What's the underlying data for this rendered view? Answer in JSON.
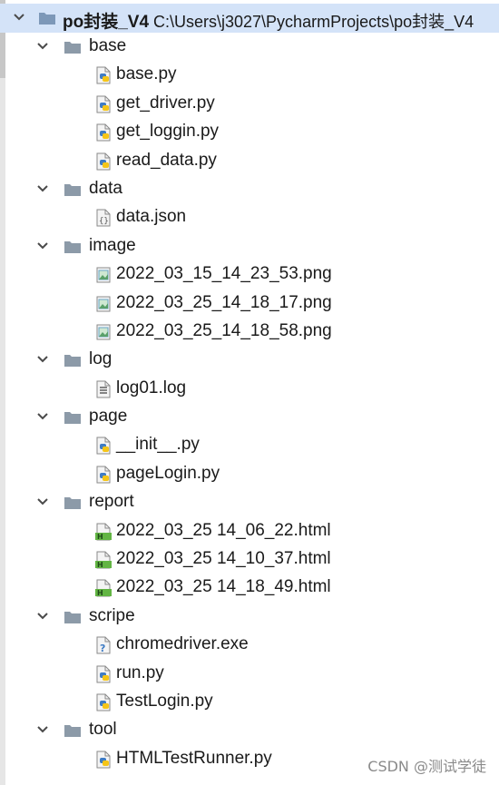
{
  "project": {
    "name": "po封装_V4",
    "path": "C:\\Users\\j3027\\PycharmProjects\\po封装_V4"
  },
  "tree": [
    {
      "kind": "folder",
      "label": "base",
      "depth": 1
    },
    {
      "kind": "python",
      "label": "base.py",
      "depth": 2
    },
    {
      "kind": "python",
      "label": "get_driver.py",
      "depth": 2
    },
    {
      "kind": "python",
      "label": "get_loggin.py",
      "depth": 2
    },
    {
      "kind": "python",
      "label": "read_data.py",
      "depth": 2
    },
    {
      "kind": "folder",
      "label": "data",
      "depth": 1
    },
    {
      "kind": "json",
      "label": "data.json",
      "depth": 2
    },
    {
      "kind": "folder",
      "label": "image",
      "depth": 1
    },
    {
      "kind": "png",
      "label": "2022_03_15_14_23_53.png",
      "depth": 2
    },
    {
      "kind": "png",
      "label": "2022_03_25_14_18_17.png",
      "depth": 2
    },
    {
      "kind": "png",
      "label": "2022_03_25_14_18_58.png",
      "depth": 2
    },
    {
      "kind": "folder",
      "label": "log",
      "depth": 1
    },
    {
      "kind": "log",
      "label": "log01.log",
      "depth": 2
    },
    {
      "kind": "folder",
      "label": "page",
      "depth": 1
    },
    {
      "kind": "python",
      "label": "__init__.py",
      "depth": 2
    },
    {
      "kind": "python",
      "label": "pageLogin.py",
      "depth": 2
    },
    {
      "kind": "folder",
      "label": "report",
      "depth": 1
    },
    {
      "kind": "html",
      "label": "2022_03_25 14_06_22.html",
      "depth": 2
    },
    {
      "kind": "html",
      "label": "2022_03_25 14_10_37.html",
      "depth": 2
    },
    {
      "kind": "html",
      "label": "2022_03_25 14_18_49.html",
      "depth": 2
    },
    {
      "kind": "folder",
      "label": "scripe",
      "depth": 1
    },
    {
      "kind": "unknown",
      "label": "chromedriver.exe",
      "depth": 2
    },
    {
      "kind": "python",
      "label": "run.py",
      "depth": 2
    },
    {
      "kind": "python",
      "label": "TestLogin.py",
      "depth": 2
    },
    {
      "kind": "folder",
      "label": "tool",
      "depth": 1
    },
    {
      "kind": "python",
      "label": "HTMLTestRunner.py",
      "depth": 2
    }
  ],
  "watermark": "CSDN @测试学徒",
  "colors": {
    "selection": "#d4e3f8",
    "folder": "#8c9aa8",
    "python_blue": "#3f7cc4",
    "python_yellow": "#f5c518",
    "html_green": "#62b543",
    "text": "#1a1a1a",
    "watermark": "#8a8a8a"
  }
}
